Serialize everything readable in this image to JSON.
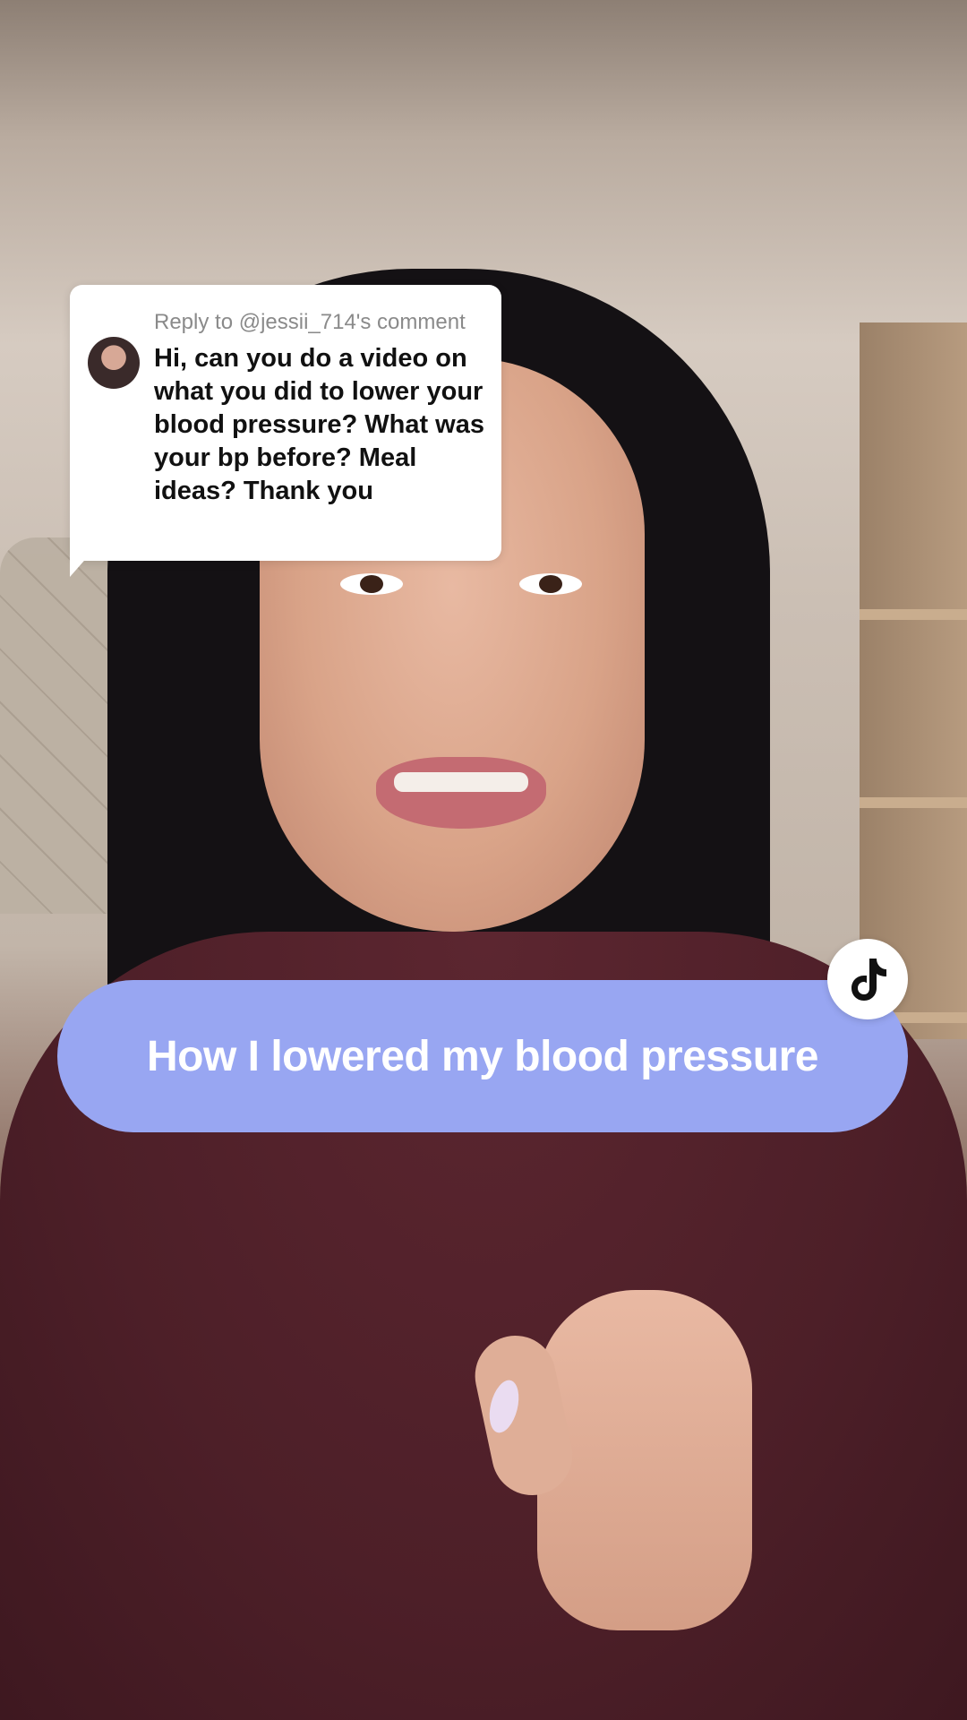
{
  "reply": {
    "header": "Reply to @jessii_714's comment",
    "comment": "Hi, can you do a video on what you did to lower your blood pressure? What was your bp before? Meal ideas? Thank you"
  },
  "caption": {
    "title": "How I lowered my blood pressure"
  },
  "colors": {
    "caption_bg": "#98a6f2",
    "caption_text": "#ffffff",
    "card_bg": "#ffffff"
  },
  "icons": {
    "avatar": "commenter-avatar",
    "badge": "tiktok-logo-icon"
  }
}
